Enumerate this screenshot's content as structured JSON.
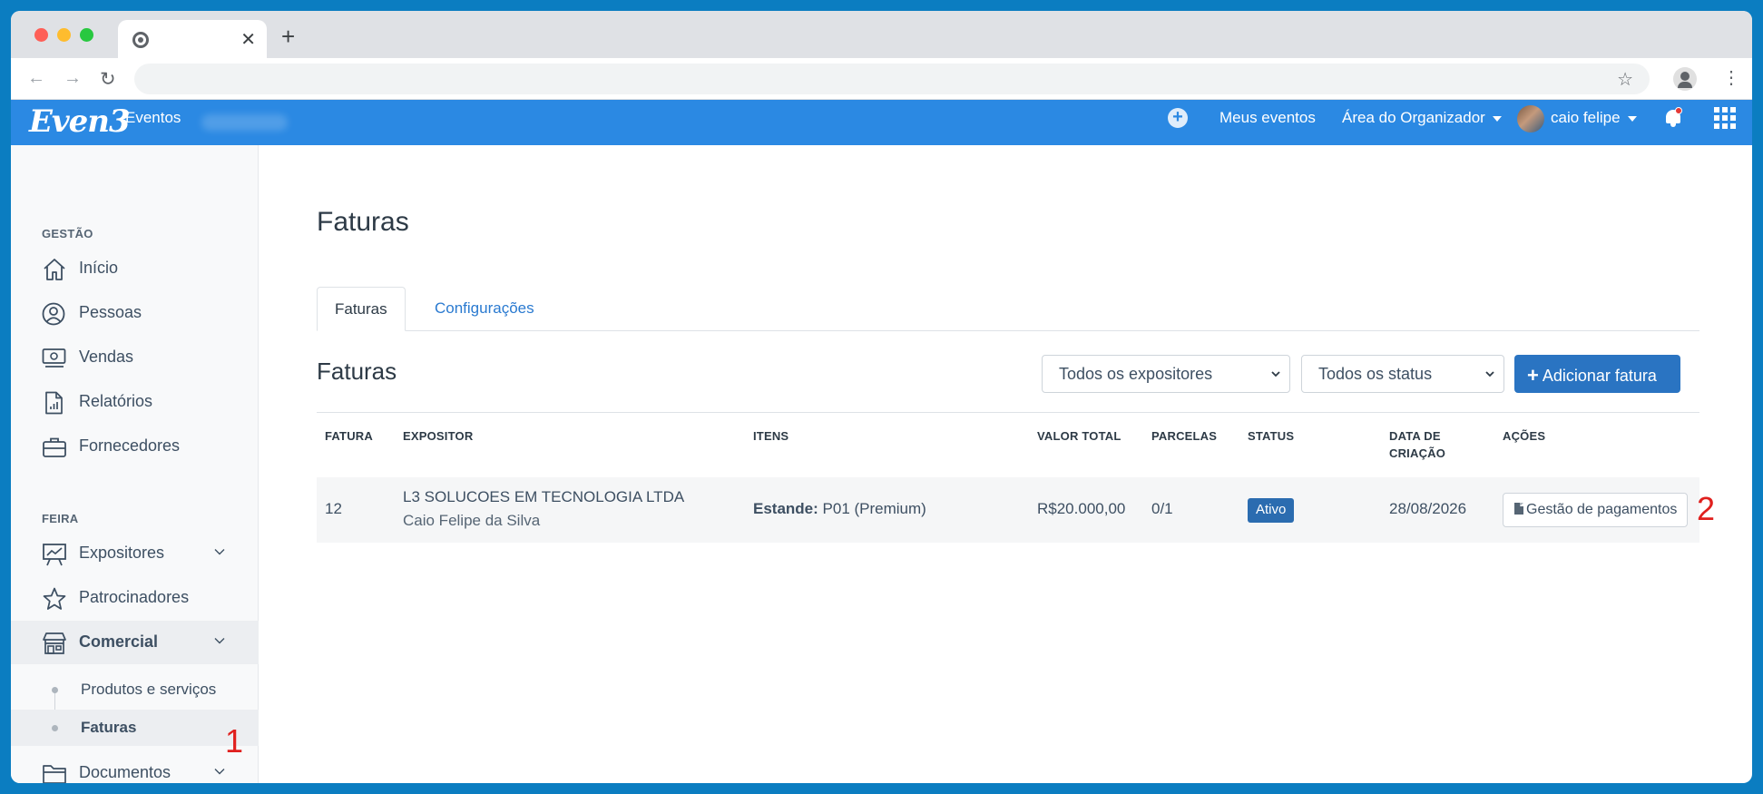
{
  "browser": {
    "tab_close": "✕",
    "new_tab": "+",
    "back": "←",
    "forward": "→",
    "reload": "↻",
    "star": "☆",
    "menu": "⋮"
  },
  "header": {
    "logo": "Even3",
    "logo_sub": "Eventos",
    "add_icon": "+",
    "my_events": "Meus eventos",
    "organizer_area": "Área do Organizador",
    "user_name": "caio felipe"
  },
  "sidebar": {
    "section_gestao": "GESTÃO",
    "section_feira": "FEIRA",
    "items": {
      "inicio": "Início",
      "pessoas": "Pessoas",
      "vendas": "Vendas",
      "relatorios": "Relatórios",
      "fornecedores": "Fornecedores",
      "expositores": "Expositores",
      "patrocinadores": "Patrocinadores",
      "comercial": "Comercial",
      "documentos": "Documentos"
    },
    "sub_items": {
      "produtos": "Produtos e serviços",
      "faturas": "Faturas"
    }
  },
  "annotations": {
    "one": "1",
    "two": "2"
  },
  "main": {
    "title": "Faturas",
    "tabs": [
      "Faturas",
      "Configurações"
    ],
    "section_title": "Faturas",
    "filter_exhibitors": "Todos os expositores",
    "filter_status": "Todos os status",
    "add_button": "Adicionar fatura",
    "add_button_icon": "+",
    "table": {
      "headers": {
        "fatura": "FATURA",
        "expositor": "EXPOSITOR",
        "itens": "ITENS",
        "valor_total": "VALOR TOTAL",
        "parcelas": "PARCELAS",
        "status": "STATUS",
        "data_1": "DATA DE",
        "data_2": "CRIAÇÃO",
        "acoes": "AÇÕES"
      },
      "rows": [
        {
          "fatura": "12",
          "expositor_company": "L3 SOLUCOES EM TECNOLOGIA LTDA",
          "expositor_person": "Caio Felipe da Silva",
          "itens_label": "Estande:",
          "itens_value": "P01 (Premium)",
          "valor_total": "R$20.000,00",
          "parcelas": "0/1",
          "status": "Ativo",
          "data_criacao": "28/08/2026",
          "action": "Gestão de pagamentos"
        }
      ]
    }
  },
  "colors": {
    "brand_blue": "#2b89e3",
    "primary_button": "#2a74c2",
    "badge": "#2b6cb0",
    "annotation_red": "#e0201e"
  }
}
